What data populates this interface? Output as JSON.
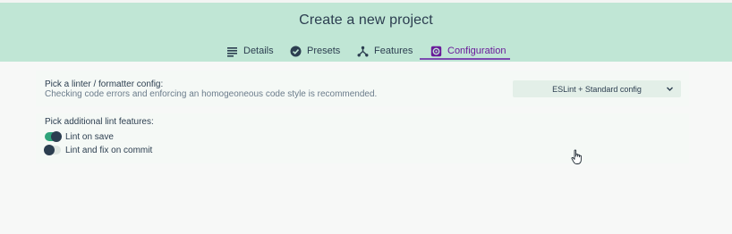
{
  "header": {
    "title": "Create a new project",
    "tabs": [
      {
        "label": "Details",
        "icon": "list-icon"
      },
      {
        "label": "Presets",
        "icon": "check-circle-icon"
      },
      {
        "label": "Features",
        "icon": "fork-icon"
      },
      {
        "label": "Configuration",
        "icon": "settings-icon"
      }
    ],
    "active_tab": "Configuration"
  },
  "linter": {
    "label": "Pick a linter / formatter config:",
    "description": "Checking code errors and enforcing an homogeoneous code style is recommended.",
    "selected": "ESLint + Standard config"
  },
  "lint_features": {
    "label": "Pick additional lint features:",
    "options": [
      {
        "label": "Lint on save",
        "enabled": true
      },
      {
        "label": "Lint and fix on commit",
        "enabled": false
      }
    ]
  },
  "colors": {
    "header_bg": "#c0e6d5",
    "accent": "#7b4bb0",
    "toggle_on": "#2fa37a",
    "text": "#2c3e50"
  }
}
